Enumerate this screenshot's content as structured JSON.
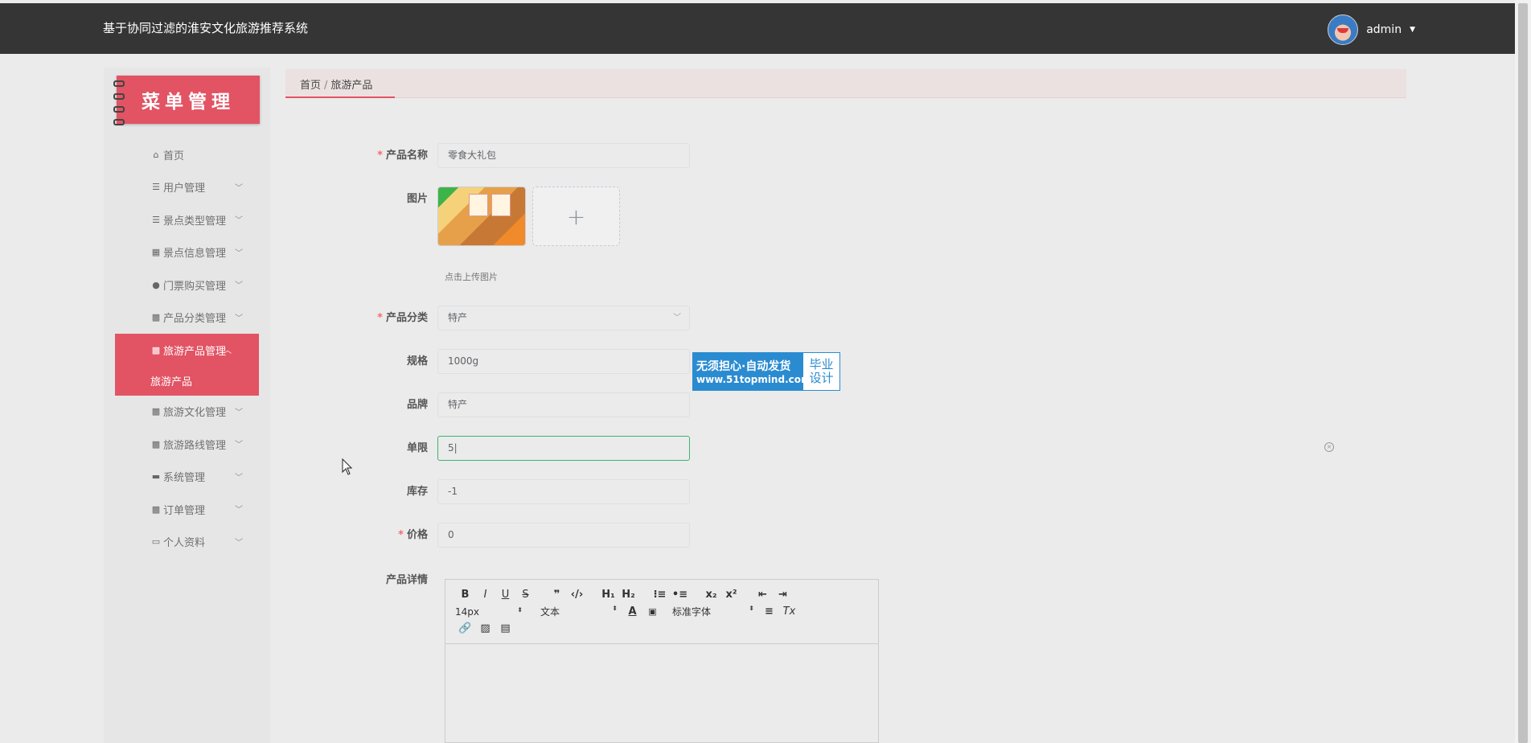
{
  "header": {
    "title": "基于协同过滤的淮安文化旅游推荐系统",
    "username": "admin"
  },
  "sidebar": {
    "title": "菜单管理",
    "items": [
      {
        "label": "首页",
        "icon": "home-icon"
      },
      {
        "label": "用户管理",
        "icon": "list-icon"
      },
      {
        "label": "景点类型管理",
        "icon": "list-icon"
      },
      {
        "label": "景点信息管理",
        "icon": "grid-icon"
      },
      {
        "label": "门票购买管理",
        "icon": "user-icon"
      },
      {
        "label": "产品分类管理",
        "icon": "apps-icon"
      },
      {
        "label": "旅游产品管理",
        "icon": "apps-icon",
        "active": true
      },
      {
        "label": "旅游文化管理",
        "icon": "apps-icon"
      },
      {
        "label": "旅游路线管理",
        "icon": "apps-icon"
      },
      {
        "label": "系统管理",
        "icon": "monitor-icon"
      },
      {
        "label": "订单管理",
        "icon": "apps-icon"
      },
      {
        "label": "个人资料",
        "icon": "card-icon"
      }
    ],
    "submenu_active": "旅游产品"
  },
  "breadcrumb": {
    "home": "首页",
    "separator": "/",
    "current": "旅游产品"
  },
  "form": {
    "name_label": "产品名称",
    "name_value": "零食大礼包",
    "image_label": "图片",
    "upload_plus": "+",
    "upload_hint": "点击上传图片",
    "category_label": "产品分类",
    "category_value": "特产",
    "spec_label": "规格",
    "spec_value": "1000g",
    "brand_label": "品牌",
    "brand_value": "特产",
    "limit_label": "单限",
    "limit_value": "5|",
    "stock_label": "库存",
    "stock_value": "-1",
    "price_label": "价格",
    "price_value": "0",
    "detail_label": "产品详情",
    "required_mark": "*"
  },
  "editor": {
    "font_size": "14px",
    "paragraph": "文本",
    "font_family": "标准字体"
  },
  "watermark": {
    "line1": "无须担心·自动发货",
    "line2": "www.51topmind.com",
    "right1": "毕业",
    "right2": "设计"
  },
  "colors": {
    "accent": "#e25364",
    "header_bg": "#353535",
    "focus": "#3cb371",
    "required": "#f56c6c"
  }
}
